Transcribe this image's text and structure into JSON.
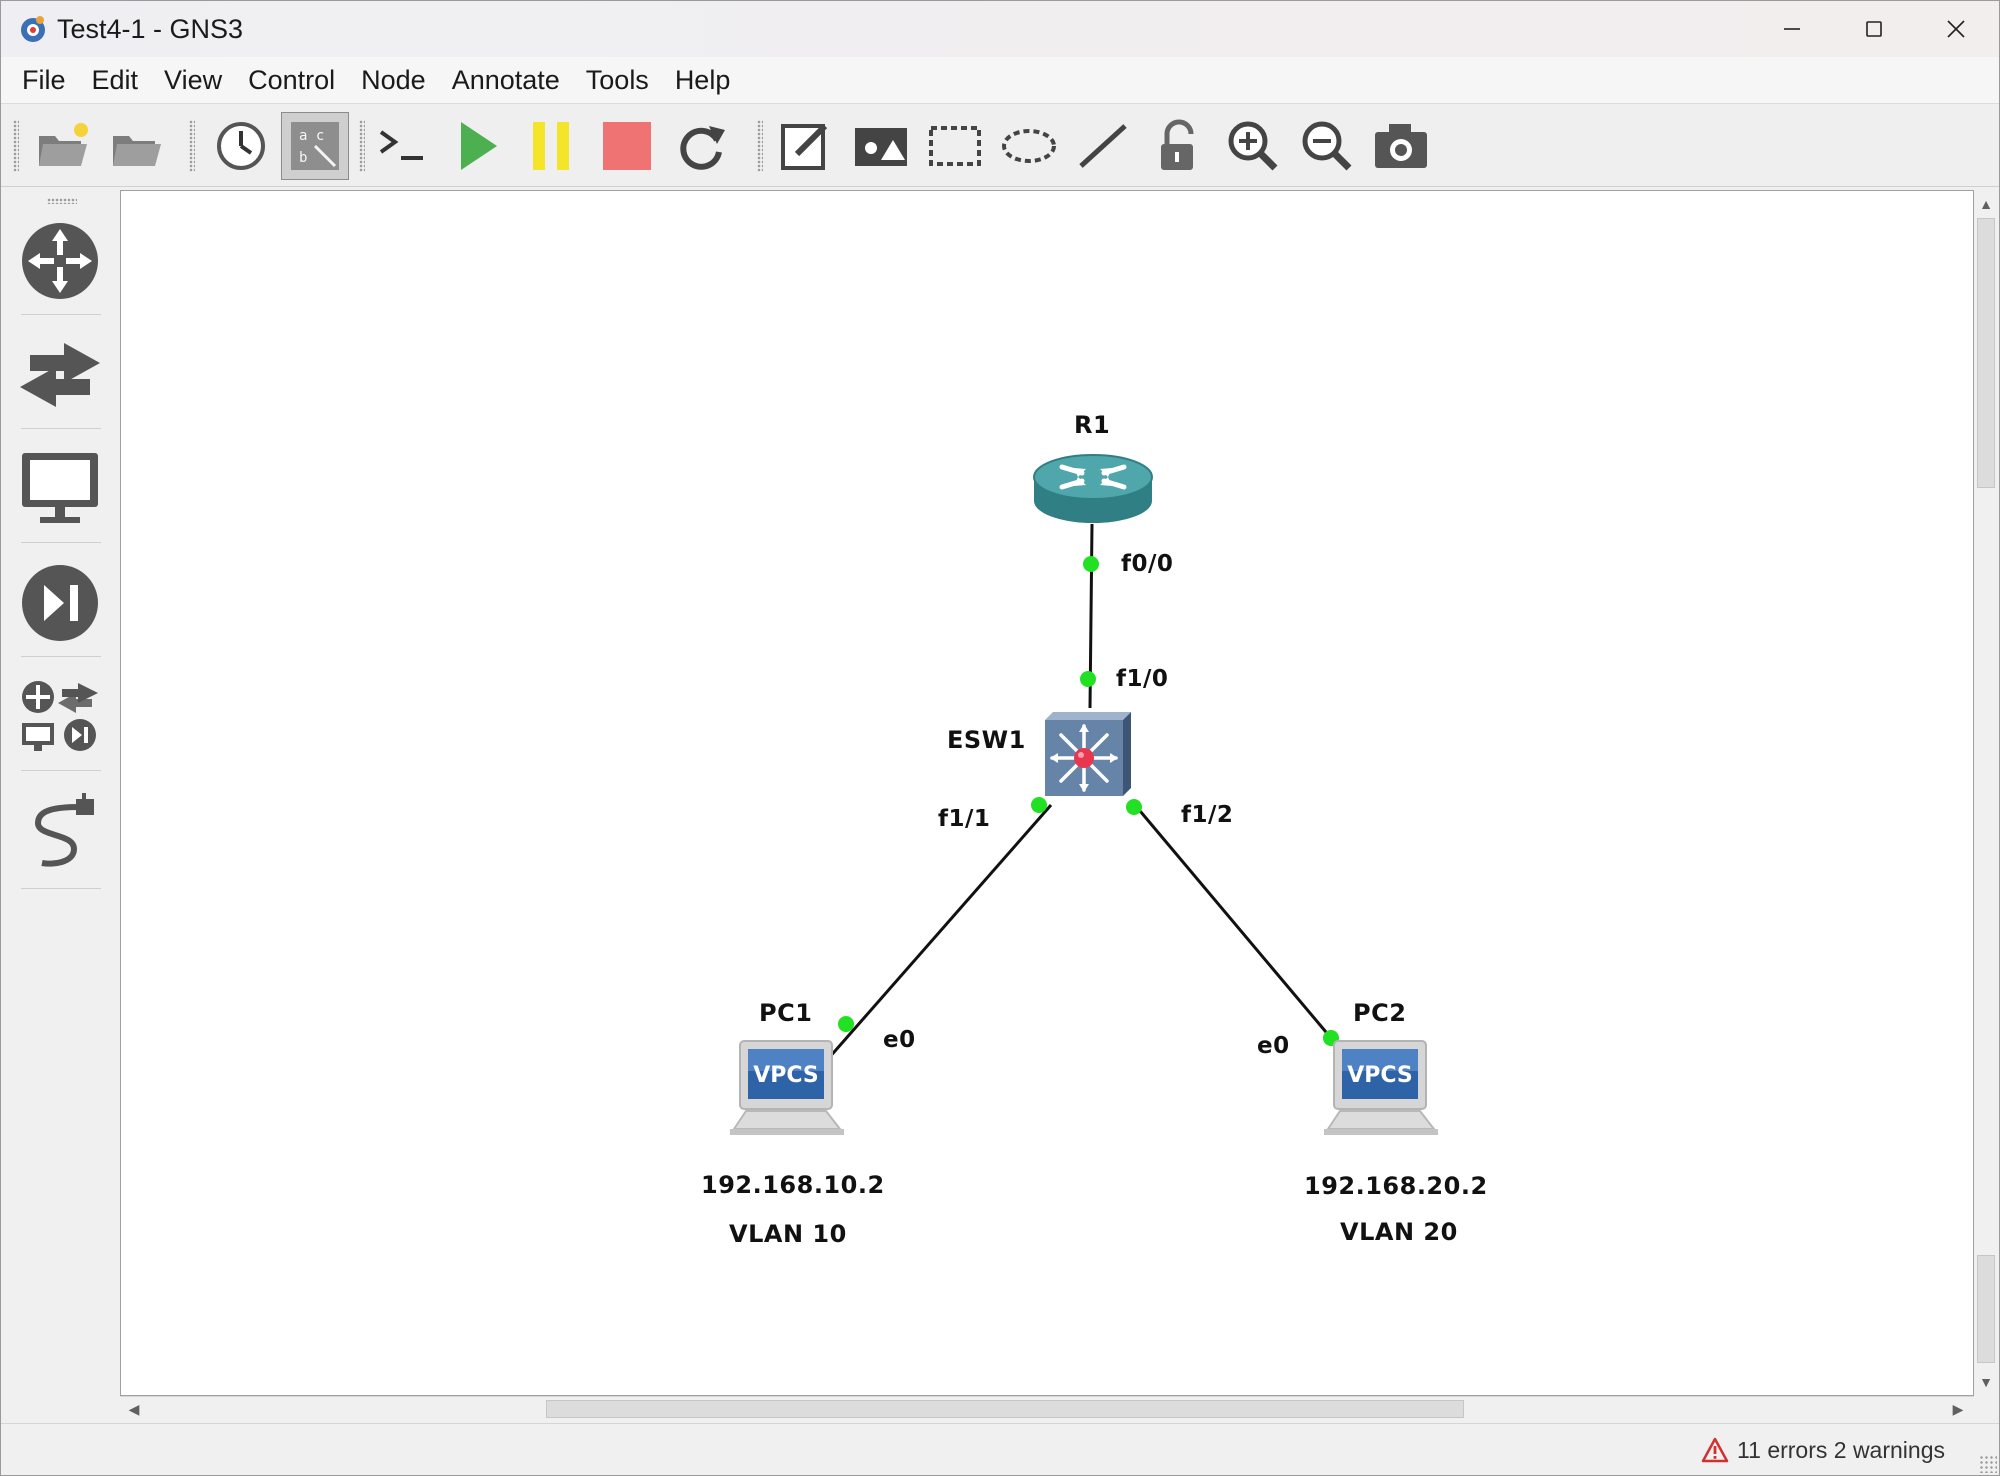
{
  "window": {
    "title": "Test4-1 - GNS3",
    "app_icon": "gns3-logo-icon"
  },
  "menu": {
    "items": [
      "File",
      "Edit",
      "View",
      "Control",
      "Node",
      "Annotate",
      "Tools",
      "Help"
    ]
  },
  "toolbar": {
    "buttons": [
      "new-project-icon",
      "open-project-icon",
      "snapshot-icon",
      "show-interface-labels-icon",
      "console-icon",
      "start-icon",
      "suspend-icon",
      "stop-icon",
      "reload-icon",
      "add-note-icon",
      "insert-picture-icon",
      "draw-rectangle-icon",
      "draw-ellipse-icon",
      "draw-line-icon",
      "lock-icon",
      "zoom-in-icon",
      "zoom-out-icon",
      "screenshot-icon"
    ],
    "active": "show-interface-labels-icon",
    "colors": {
      "start": "#4caf50",
      "suspend": "#f5e52a",
      "stop": "#f07373"
    }
  },
  "device_panel": {
    "buttons": [
      "routers-icon",
      "switches-icon",
      "end-devices-icon",
      "security-devices-icon",
      "all-devices-icon",
      "add-link-icon"
    ]
  },
  "topology": {
    "nodes": {
      "r1": {
        "label": "R1"
      },
      "esw1": {
        "label": "ESW1"
      },
      "pc1": {
        "label": "PC1",
        "badge": "VPCS"
      },
      "pc2": {
        "label": "PC2",
        "badge": "VPCS"
      }
    },
    "ports": {
      "r1_f00": "f0/0",
      "esw1_f10": "f1/0",
      "esw1_f11": "f1/1",
      "esw1_f12": "f1/2",
      "pc1_e0": "e0",
      "pc2_e0": "e0"
    },
    "notes": {
      "pc1_ip": "192.168.10.2",
      "pc1_vlan": "VLAN 10",
      "pc2_ip": "192.168.20.2",
      "pc2_vlan": "VLAN 20"
    },
    "link_status_color": "#22e022"
  },
  "status": {
    "message": "11 errors 2 warnings",
    "icon": "warning-triangle-icon",
    "icon_color": "#d32f2f"
  }
}
